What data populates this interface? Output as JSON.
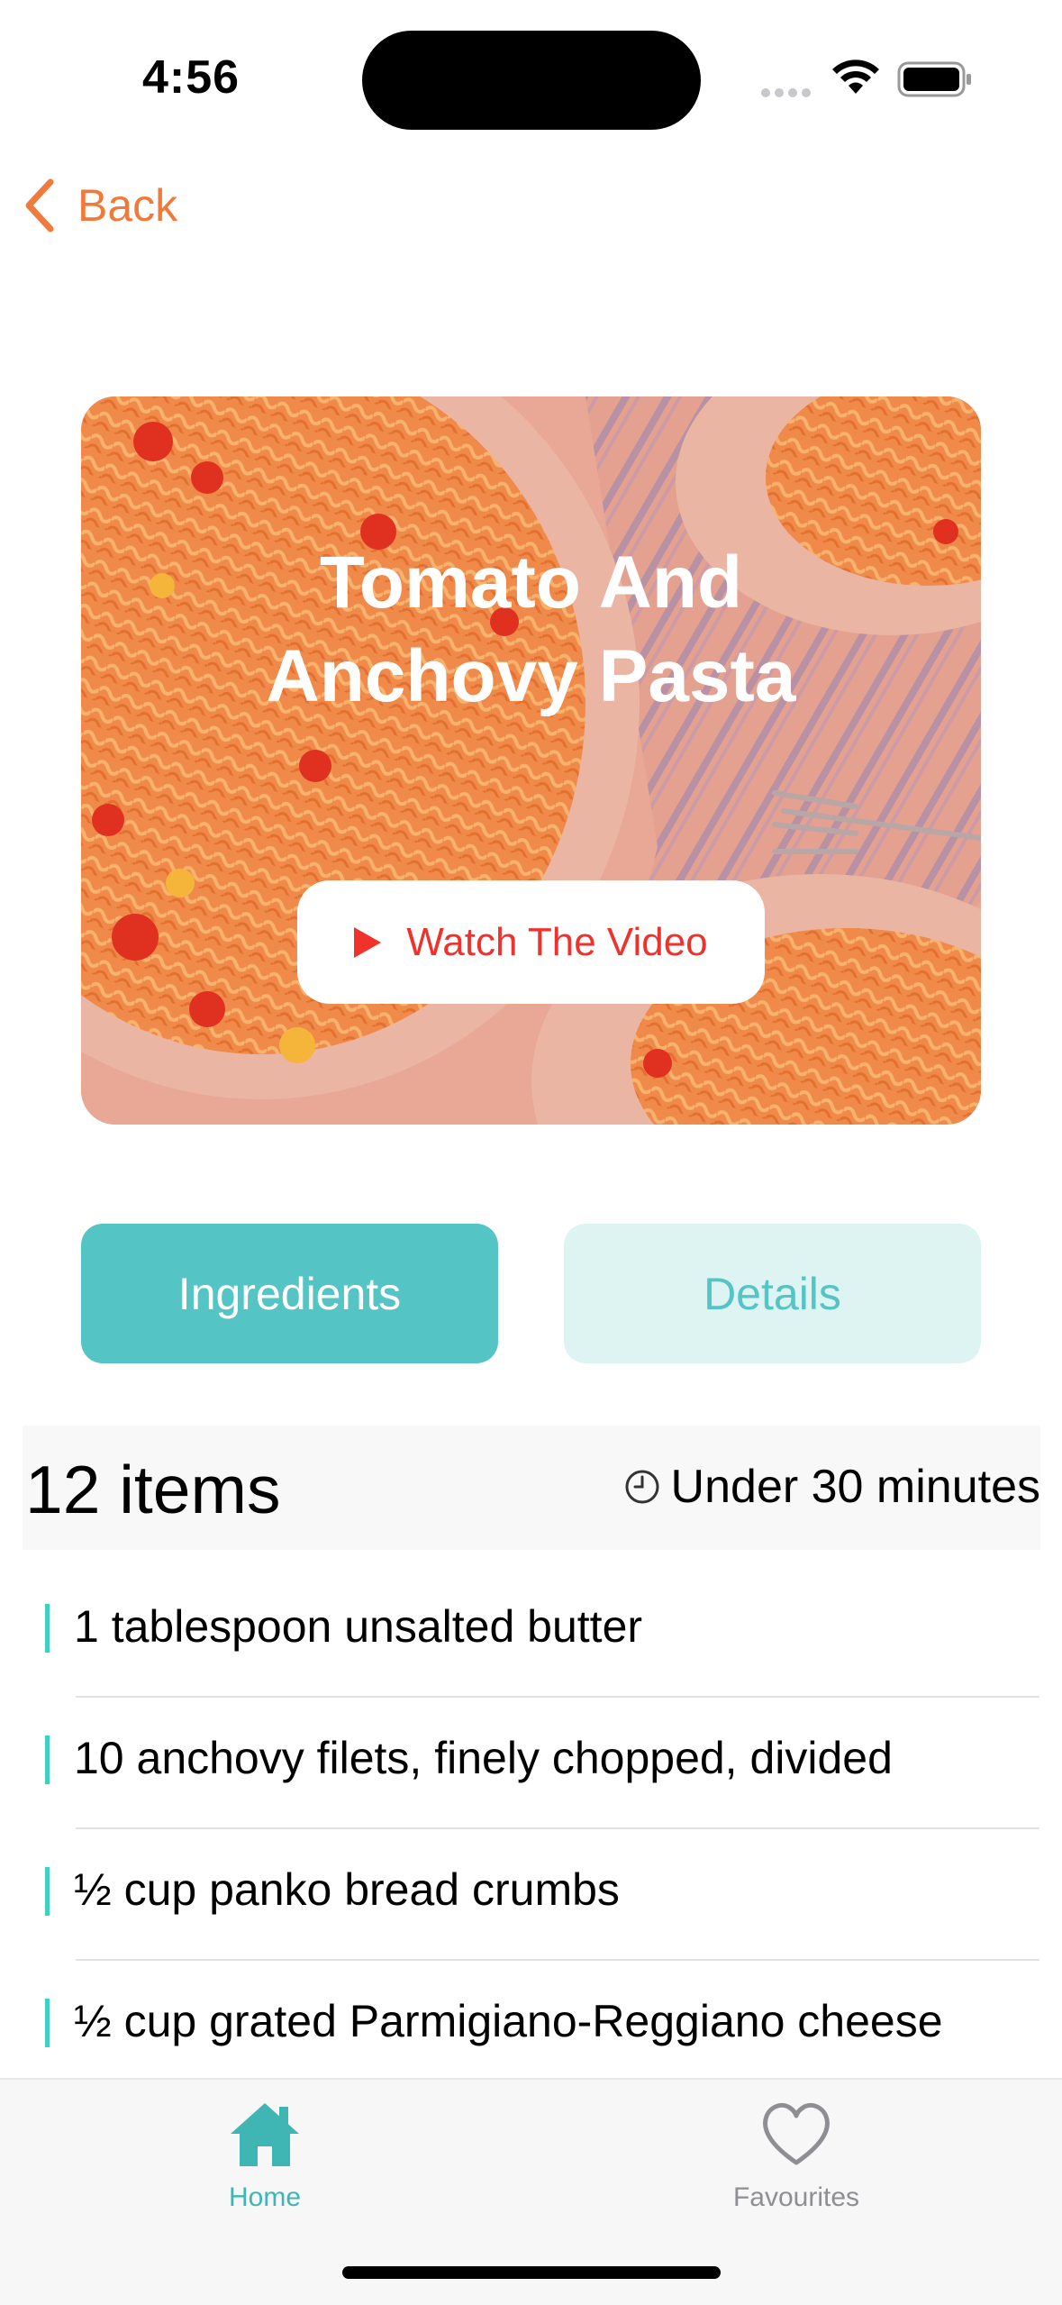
{
  "status_bar": {
    "time": "4:56"
  },
  "nav": {
    "back_label": "Back"
  },
  "recipe": {
    "title_line1": "Tomato And",
    "title_line2": "Anchovy Pasta",
    "video_button_label": "Watch The Video"
  },
  "tabs": [
    {
      "label": "Ingredients",
      "active": true
    },
    {
      "label": "Details",
      "active": false
    }
  ],
  "summary": {
    "items_count": "12 items",
    "duration": "Under 30 minutes"
  },
  "ingredients": [
    "1 tablespoon unsalted butter",
    "10 anchovy filets, finely chopped, divided",
    "½ cup panko bread crumbs",
    "½ cup grated Parmigiano-Reggiano cheese"
  ],
  "tab_bar": {
    "home_label": "Home",
    "favourites_label": "Favourites"
  },
  "colors": {
    "accent_orange": "#f07a3c",
    "accent_teal": "#55c4c4",
    "video_red": "#f0322c"
  },
  "icons": [
    "chevron-left-icon",
    "play-icon",
    "clock-icon",
    "home-icon",
    "heart-icon",
    "wifi-icon",
    "battery-icon"
  ]
}
